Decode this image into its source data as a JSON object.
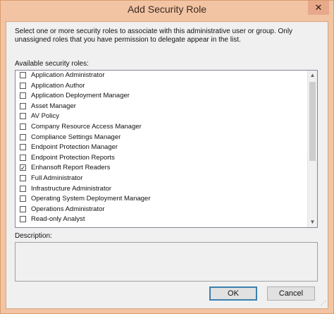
{
  "window": {
    "title": "Add Security Role",
    "close_glyph": "✕",
    "frame_color": "#f2c4a4"
  },
  "intro_text": "Select one or more security roles to associate with this administrative user or group.  Only unassigned roles that you have permission to delegate appear in the list.",
  "roles_label": "Available security roles:",
  "roles": [
    {
      "label": "Application Administrator",
      "checked": false
    },
    {
      "label": "Application Author",
      "checked": false
    },
    {
      "label": "Application Deployment Manager",
      "checked": false
    },
    {
      "label": "Asset Manager",
      "checked": false
    },
    {
      "label": "AV Policy",
      "checked": false
    },
    {
      "label": "Company Resource Access Manager",
      "checked": false
    },
    {
      "label": "Compliance Settings Manager",
      "checked": false
    },
    {
      "label": "Endpoint Protection Manager",
      "checked": false
    },
    {
      "label": "Endpoint Protection Reports",
      "checked": false
    },
    {
      "label": "Enhansoft Report Readers",
      "checked": true
    },
    {
      "label": "Full Administrator",
      "checked": false
    },
    {
      "label": "Infrastructure Administrator",
      "checked": false
    },
    {
      "label": "Operating System Deployment Manager",
      "checked": false
    },
    {
      "label": "Operations Administrator",
      "checked": false
    },
    {
      "label": "Read-only Analyst",
      "checked": false
    }
  ],
  "scrollbar": {
    "up_glyph": "▲",
    "down_glyph": "▼"
  },
  "check_glyph": "✓",
  "description_label": "Description:",
  "buttons": {
    "ok": "OK",
    "cancel": "Cancel"
  }
}
